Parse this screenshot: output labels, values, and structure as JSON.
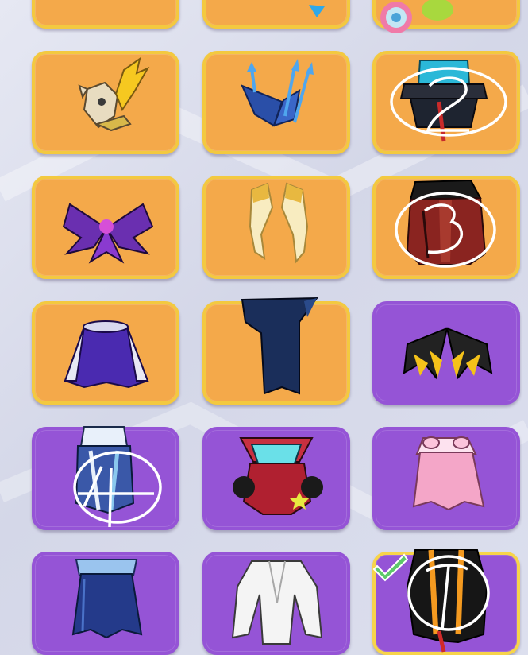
{
  "grid": {
    "tiles": [
      {
        "id": "row0-col0",
        "rarity": "orange",
        "item": "partial-item",
        "mark": ""
      },
      {
        "id": "row0-col1",
        "rarity": "orange",
        "item": "partial-item",
        "mark": ""
      },
      {
        "id": "row0-col2",
        "rarity": "orange",
        "item": "partial-item",
        "mark": ""
      },
      {
        "id": "golden-headdress",
        "rarity": "orange",
        "item": "golden-horned-headdress",
        "mark": ""
      },
      {
        "id": "trident-wings",
        "rarity": "orange",
        "item": "blue-trident-wings",
        "mark": ""
      },
      {
        "id": "teal-hat",
        "rarity": "orange",
        "item": "teal-top-hat",
        "mark": "2"
      },
      {
        "id": "spider-wings",
        "rarity": "orange",
        "item": "purple-spider-wings",
        "mark": ""
      },
      {
        "id": "feather-wings",
        "rarity": "orange",
        "item": "golden-feather-wings",
        "mark": ""
      },
      {
        "id": "red-hood",
        "rarity": "orange",
        "item": "red-black-hood",
        "mark": "3"
      },
      {
        "id": "galaxy-cape",
        "rarity": "orange",
        "item": "galaxy-cape",
        "mark": ""
      },
      {
        "id": "navy-scarf",
        "rarity": "orange",
        "item": "navy-scarf",
        "mark": ""
      },
      {
        "id": "gold-black-wings",
        "rarity": "purple",
        "item": "gold-black-wings",
        "mark": ""
      },
      {
        "id": "ice-armor",
        "rarity": "purple",
        "item": "ice-armor",
        "mark": "4"
      },
      {
        "id": "cyan-collar",
        "rarity": "purple",
        "item": "cyan-collar-cape",
        "mark": ""
      },
      {
        "id": "pink-cape",
        "rarity": "purple",
        "item": "pink-cape",
        "mark": ""
      },
      {
        "id": "blue-cape",
        "rarity": "purple",
        "item": "blue-cape",
        "mark": ""
      },
      {
        "id": "white-jacket",
        "rarity": "purple",
        "item": "white-jacket",
        "mark": ""
      },
      {
        "id": "orange-black-cape",
        "rarity": "purple",
        "item": "orange-black-cape",
        "mark": "1",
        "selected": true
      }
    ]
  },
  "colors": {
    "orange_tile": "#f4a94a",
    "purple_tile": "#9554d6",
    "gold_border": "#f3c940",
    "checkmark": "#5cc86a"
  },
  "icons": {
    "selected": "checkmark-icon"
  }
}
